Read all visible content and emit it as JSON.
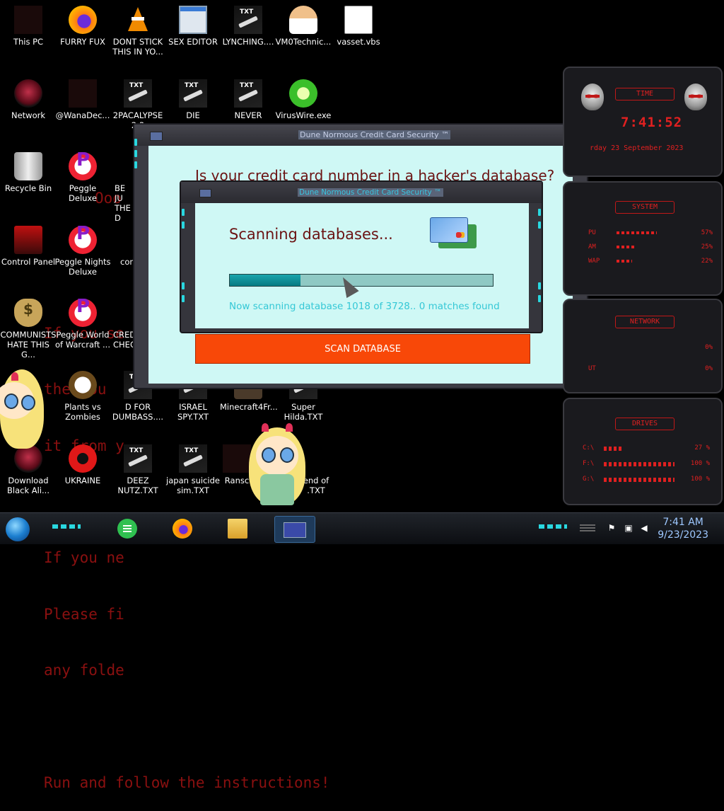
{
  "background_text": [
    "Ooo",
    "If you se",
    "the you",
    "it from y",
    "If you ne",
    "Please fi",
    "any folde",
    "Run and follow the instructions!"
  ],
  "desktop_icons": [
    {
      "label": "This PC",
      "icon": "computer-icon"
    },
    {
      "label": "FURRY FUX",
      "icon": "firefox-icon"
    },
    {
      "label": "DONT STICK THIS IN YO...",
      "icon": "vlc-cone-icon"
    },
    {
      "label": "SEX EDITOR",
      "icon": "window-app-icon"
    },
    {
      "label": "LYNCHING....",
      "icon": "txt-file-icon"
    },
    {
      "label": "VM0Technic...",
      "icon": "doctor-icon"
    },
    {
      "label": "vasset.vbs",
      "icon": "script-file-icon"
    },
    {
      "label": "Network",
      "icon": "alien-network-icon"
    },
    {
      "label": "@WanaDec...",
      "icon": "dark-app-icon"
    },
    {
      "label": "2PACALYPSE 2.3",
      "icon": "txt-file-icon"
    },
    {
      "label": "DIE",
      "icon": "txt-file-icon"
    },
    {
      "label": "NEVER",
      "icon": "txt-file-icon"
    },
    {
      "label": "VirusWire.exe",
      "icon": "lime-icon"
    },
    {
      "label": "Recycle Bin",
      "icon": "recycle-bin-icon"
    },
    {
      "label": "Peggle Deluxe",
      "icon": "peggle-icon"
    },
    {
      "label": "BE JU THE D",
      "icon": "txt-file-icon"
    },
    {
      "label": "Control Panel",
      "icon": "control-panel-icon"
    },
    {
      "label": "Peggle Nights Deluxe",
      "icon": "peggle-icon"
    },
    {
      "label": "com",
      "icon": "app-icon"
    },
    {
      "label": "COMMUNISTS HATE THIS G...",
      "icon": "money-bag-icon"
    },
    {
      "label": "Peggle World of Warcraft ...",
      "icon": "peggle-icon"
    },
    {
      "label": "CRED CHEC",
      "icon": "txt-file-icon"
    },
    {
      "label": "Plants vs Zombies",
      "icon": "flower-icon"
    },
    {
      "label": "D FOR DUMBASS....",
      "icon": "txt-file-icon"
    },
    {
      "label": "ISRAEL SPY.TXT",
      "icon": "txt-file-icon"
    },
    {
      "label": "Minecraft4Fr...",
      "icon": "minecraft-icon"
    },
    {
      "label": "Super Hilda.TXT",
      "icon": "txt-file-icon"
    },
    {
      "label": "Download Black Ali...",
      "icon": "alien-network-icon"
    },
    {
      "label": "UKRAINE",
      "icon": "radiation-icon"
    },
    {
      "label": "DEEZ NUTZ.TXT",
      "icon": "txt-file-icon"
    },
    {
      "label": "japan suicide sim.TXT",
      "icon": "txt-file-icon"
    },
    {
      "label": "Ransc",
      "icon": "dark-app-icon"
    },
    {
      "label": "end of .TXT",
      "icon": "txt-file-icon"
    }
  ],
  "main_window": {
    "title": "Dune Normous Credit Card Security ™",
    "heading": "Is your credit card number in a hacker's database?",
    "scan_button": "SCAN DATABASE"
  },
  "scan_dialog": {
    "title": "Dune Normous Credit Card Security ™",
    "heading": "Scanning databases...",
    "progress": 0.27,
    "status": "Now scanning database 1018 of 3728.. 0 matches found"
  },
  "widgets": {
    "time": {
      "title": "TIME",
      "clock": "7:41:52",
      "date": "rday 23 September 2023"
    },
    "system": {
      "title": "SYSTEM",
      "rows": [
        {
          "label": "PU",
          "value": "57%",
          "level": 0.57
        },
        {
          "label": "AM",
          "value": "25%",
          "level": 0.25
        },
        {
          "label": "WAP",
          "value": "22%",
          "level": 0.22
        }
      ]
    },
    "network": {
      "title": "NETWORK",
      "rows": [
        {
          "label": "",
          "value": "0%"
        },
        {
          "label": "UT",
          "value": "0%"
        }
      ]
    },
    "drives": {
      "title": "DRIVES",
      "rows": [
        {
          "label": "C:\\",
          "value": "27 %",
          "level": 0.27
        },
        {
          "label": "F:\\",
          "value": "100 %",
          "level": 1.0
        },
        {
          "label": "G:\\",
          "value": "100 %",
          "level": 1.0
        }
      ]
    }
  },
  "taskbar": {
    "apps": [
      {
        "name": "notes",
        "icon": "notes-icon"
      },
      {
        "name": "firefox",
        "icon": "firefox-icon"
      },
      {
        "name": "file-explorer",
        "icon": "folder-icon"
      },
      {
        "name": "credit-card-security",
        "icon": "card-app-icon",
        "active": true
      }
    ],
    "tray": [
      "flag-icon",
      "network-icon",
      "volume-icon"
    ],
    "time": "7:41 AM",
    "date": "9/23/2023"
  },
  "colors": {
    "window_bg": "#cff8f5",
    "heading_red": "#6b1313",
    "scan_button": "#f84808",
    "status_cyan": "#35c8d6",
    "widget_red": "#e02020"
  }
}
